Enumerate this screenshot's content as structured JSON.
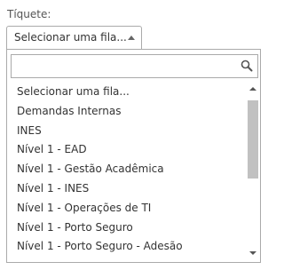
{
  "field": {
    "label": "Tíquete:",
    "selected_value": "Selecionar uma fila..."
  },
  "search": {
    "value": "",
    "placeholder": ""
  },
  "options": [
    "Selecionar uma fila...",
    "Demandas Internas",
    "INES",
    "Nível 1 - EAD",
    "Nível 1 - Gestão Acadêmica",
    "Nível 1 - INES",
    "Nível 1 - Operações de TI",
    "Nível 1 - Porto Seguro",
    "Nível 1 - Porto Seguro - Adesão"
  ],
  "icons": {
    "search": "search-icon",
    "dropdown": "chevron-up-icon"
  },
  "colors": {
    "border": "#aaaaaa",
    "text": "#333333",
    "scroll_thumb": "#c1c1c1"
  }
}
